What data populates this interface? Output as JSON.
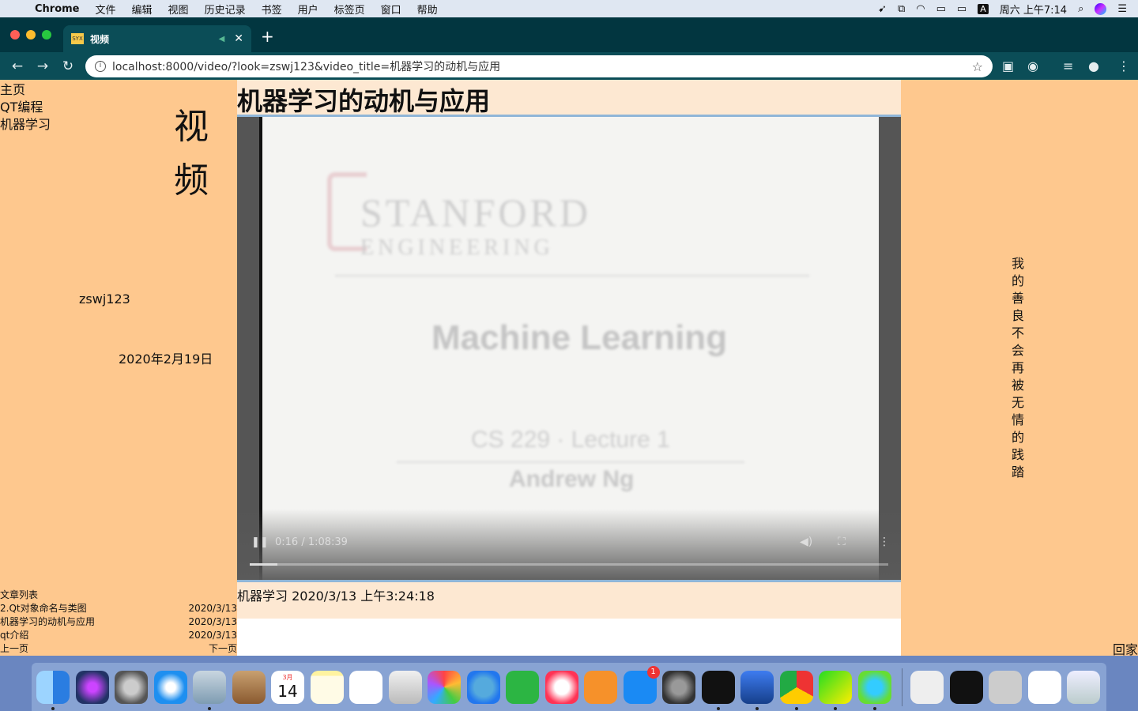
{
  "menubar": {
    "app": "Chrome",
    "items": [
      "文件",
      "编辑",
      "视图",
      "历史记录",
      "书签",
      "用户",
      "标签页",
      "窗口",
      "帮助"
    ],
    "input_method": "A",
    "clock": "周六 上午7:14"
  },
  "browser": {
    "tab_title": "视频",
    "favicon_text": "SYX",
    "url": "localhost:8000/video/?look=zswj123&video_title=机器学习的动机与应用"
  },
  "sidebar": {
    "nav": [
      "主页",
      "QT编程",
      "机器学习"
    ],
    "big_title": "视频",
    "author": "zswj123",
    "date": "2020年2月19日"
  },
  "article_list": {
    "heading": "文章列表",
    "items": [
      {
        "title": "2.Qt对象命名与类图",
        "date": "2020/3/13"
      },
      {
        "title": "机器学习的动机与应用",
        "date": "2020/3/13"
      },
      {
        "title": "qt介绍",
        "date": "2020/3/13"
      }
    ],
    "prev": "上一页",
    "next": "下一页"
  },
  "main": {
    "video_title": "机器学习的动机与应用",
    "slide": {
      "line1": "STANFORD",
      "line2": "ENGINEERING",
      "course": "Machine Learning",
      "lecture": "CS 229 · Lecture 1",
      "lecturer": "Andrew Ng"
    },
    "player": {
      "time": "0:16 / 1:08:39",
      "progress": 0.0039
    },
    "meta": "机器学习 2020/3/13 上午3:24:18"
  },
  "right": {
    "quote": "我的善良不会再被无情的践踏",
    "home": "回家"
  },
  "dock": {
    "icons": [
      "finder-icon",
      "siri-icon",
      "launchpad-icon",
      "safari-icon",
      "preview-icon",
      "contacts-icon",
      "calendar-icon",
      "notes-icon",
      "reminders-icon",
      "photo-booth-icon",
      "photos-icon",
      "messages-icon",
      "facetime-icon",
      "itunes-icon",
      "books-icon",
      "app-store-icon",
      "system-preferences-icon",
      "terminal-icon",
      "screen-sharing-icon",
      "chrome-icon",
      "pycharm-icon",
      "pixelmator-icon",
      "archive-icon",
      "terminal-window-icon",
      "preview-window-icon",
      "finder-window-icon",
      "trash-icon"
    ],
    "calendar_month": "3月",
    "calendar_day": "14",
    "app_store_badge": "1"
  }
}
